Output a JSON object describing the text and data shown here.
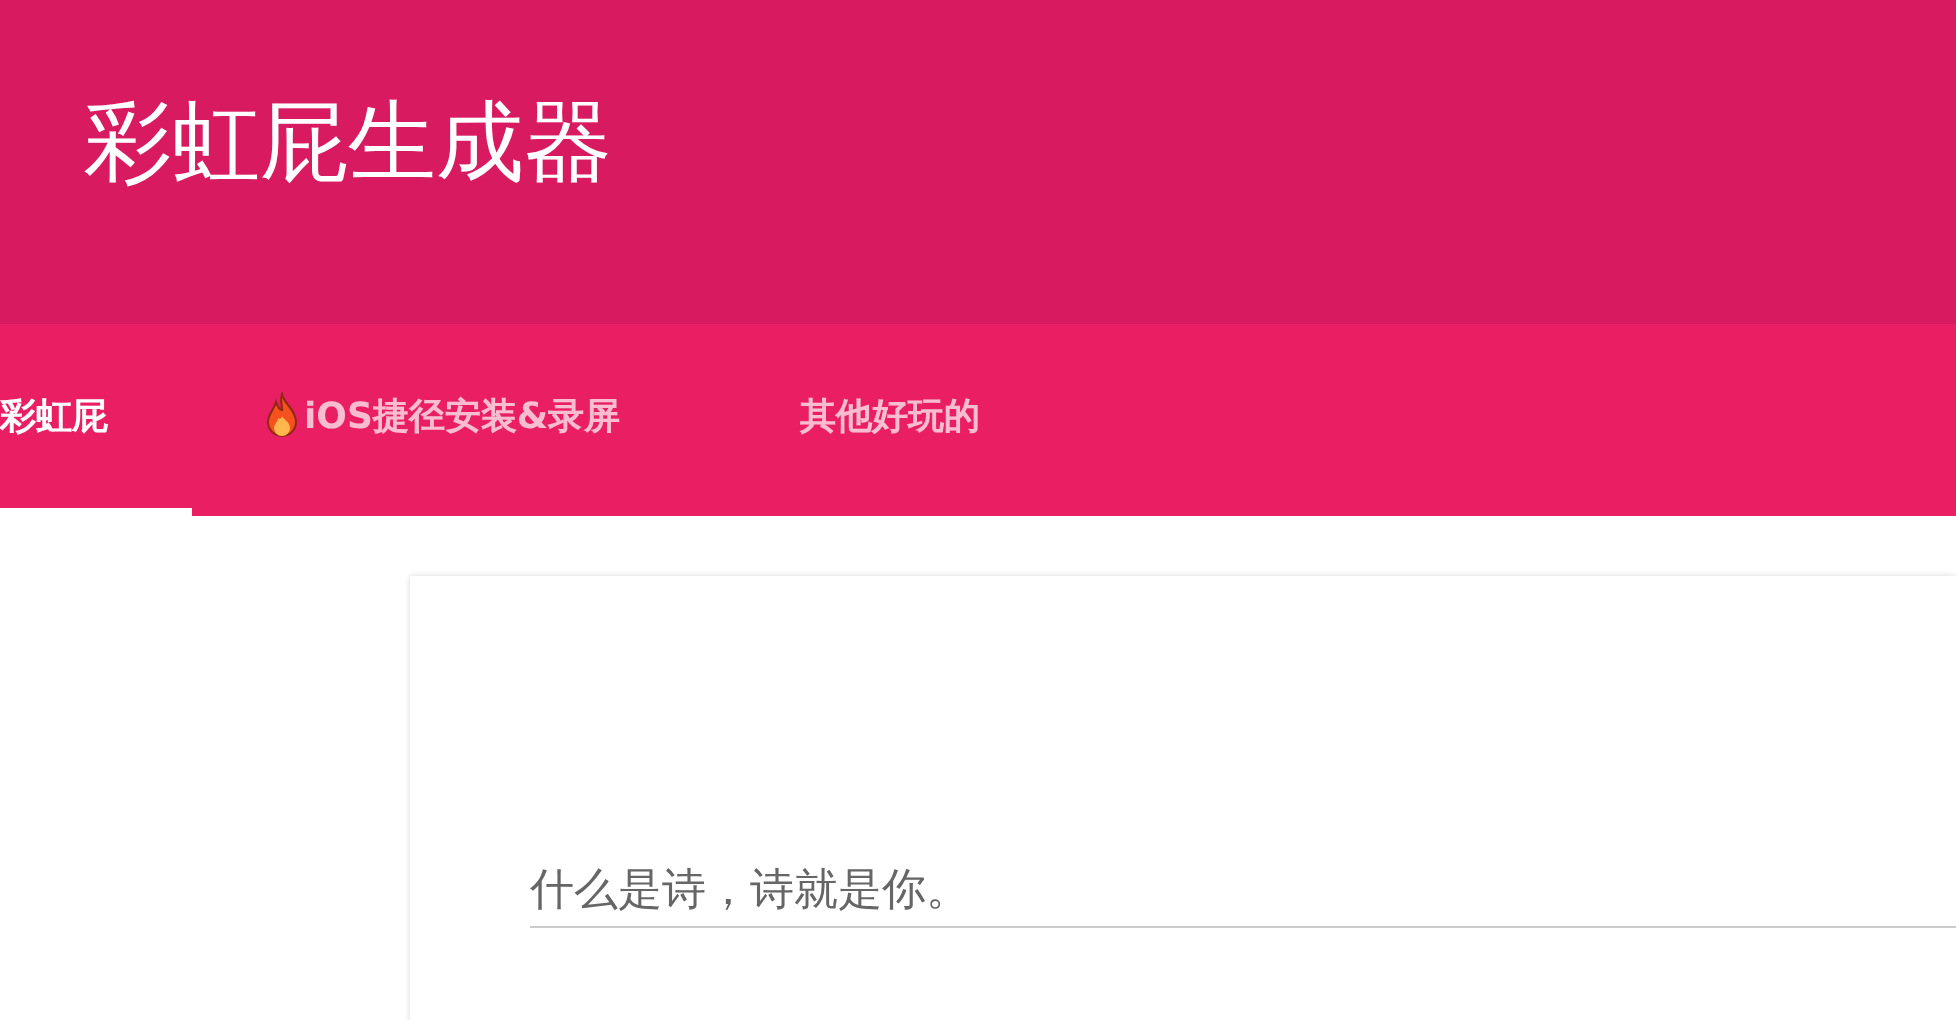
{
  "header": {
    "title": "彩虹屁生成器"
  },
  "tabs": [
    {
      "label": "彩虹屁",
      "selected": true,
      "icon": false
    },
    {
      "label": "iOS捷径安装&录屏",
      "selected": false,
      "icon": true
    },
    {
      "label": "其他好玩的",
      "selected": false,
      "icon": false
    }
  ],
  "poem_field": {
    "value": "什么是诗，诗就是你。"
  }
}
